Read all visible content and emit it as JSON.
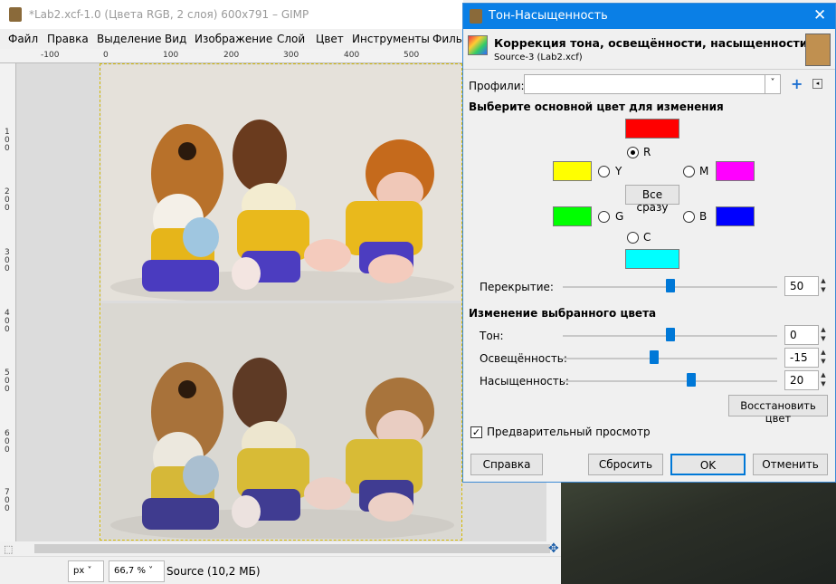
{
  "gimp": {
    "title": "*Lab2.xcf-1.0 (Цвета RGB, 2 слоя) 600x791 – GIMP",
    "menu": [
      "Файл",
      "Правка",
      "Выделение",
      "Вид",
      "Изображение",
      "Слой",
      "Цвет",
      "Инструменты",
      "Филь"
    ],
    "ruler_top": [
      "-100",
      "0",
      "100",
      "200",
      "300",
      "400",
      "500"
    ],
    "ruler_left": [
      "1\n0\n0",
      "2\n0\n0",
      "3\n0\n0",
      "4\n0\n0",
      "5\n0\n0",
      "6\n0\n0",
      "7\n0\n0"
    ],
    "status": {
      "unit": "px",
      "zoom": "66,7 %",
      "info": "Source (10,2 МБ)"
    }
  },
  "dialog": {
    "title": "Тон-Насыщенность",
    "header_title": "Коррекция тона, освещённости, насыщенности",
    "header_subtitle": "Source-3 (Lab2.xcf)",
    "presets_label": "Профили:",
    "presets_value": "",
    "primary_section": "Выберите основной цвет для изменения",
    "colors": {
      "R": {
        "label": "R",
        "color": "#ff0000",
        "selected": true
      },
      "Y": {
        "label": "Y",
        "color": "#ffff00",
        "selected": false
      },
      "M": {
        "label": "M",
        "color": "#ff00ff",
        "selected": false
      },
      "G": {
        "label": "G",
        "color": "#00ff00",
        "selected": false
      },
      "B": {
        "label": "B",
        "color": "#0000ff",
        "selected": false
      },
      "C": {
        "label": "C",
        "color": "#00ffff",
        "selected": false
      }
    },
    "all_button": "Все сразу",
    "overlap_label": "Перекрытие:",
    "overlap_value": "50",
    "overlap_fraction": 0.5,
    "adjust_section": "Изменение выбранного цвета",
    "hue_label": "Тон:",
    "hue_value": "0",
    "hue_fraction": 0.5,
    "lightness_label": "Освещённость:",
    "lightness_value": "-15",
    "lightness_fraction": 0.425,
    "saturation_label": "Насыщенность:",
    "saturation_value": "20",
    "saturation_fraction": 0.6,
    "reset_color_button": "Восстановить цвет",
    "preview_label": "Предварительный просмотр",
    "preview_checked": true,
    "buttons": {
      "help": "Справка",
      "reset": "Сбросить",
      "ok": "OK",
      "cancel": "Отменить"
    },
    "accent": "#0a7fe6"
  }
}
